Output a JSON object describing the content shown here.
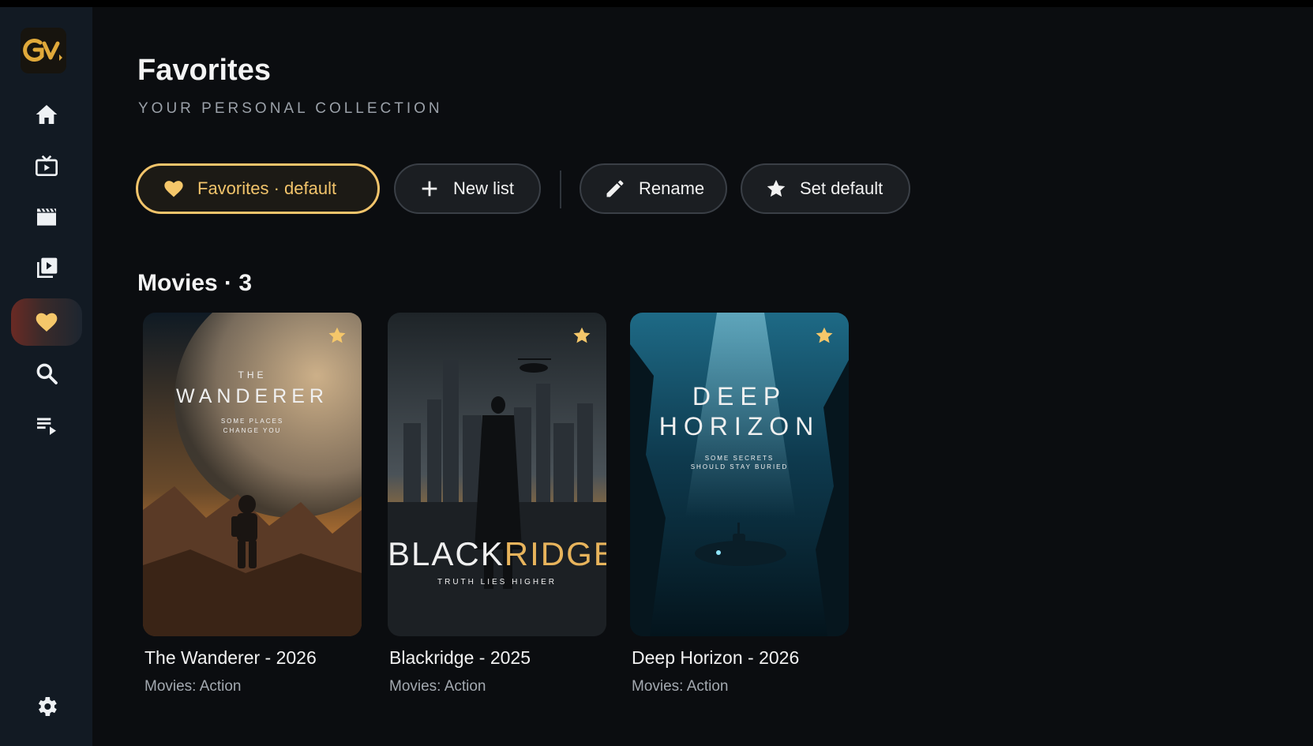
{
  "app": {
    "logo_text": "GV"
  },
  "sidebar": {
    "items": [
      {
        "name": "home",
        "icon": "home-icon",
        "active": false
      },
      {
        "name": "live-tv",
        "icon": "tv-icon",
        "active": false
      },
      {
        "name": "movies",
        "icon": "clapperboard-icon",
        "active": false
      },
      {
        "name": "series",
        "icon": "video-library-icon",
        "active": false
      },
      {
        "name": "favorites",
        "icon": "heart-icon",
        "active": true
      },
      {
        "name": "search",
        "icon": "search-icon",
        "active": false
      },
      {
        "name": "playlist",
        "icon": "playlist-play-icon",
        "active": false
      },
      {
        "name": "settings",
        "icon": "gear-icon",
        "active": false
      }
    ]
  },
  "header": {
    "title": "Favorites",
    "subtitle": "YOUR PERSONAL COLLECTION"
  },
  "toolbar": {
    "list_label": "Favorites · default",
    "new_list_label": "New list",
    "rename_label": "Rename",
    "set_default_label": "Set default"
  },
  "section": {
    "title": "Movies · 3"
  },
  "movies": [
    {
      "title": "The Wanderer - 2026",
      "category": "Movies: Action",
      "poster": {
        "kicker": "THE",
        "headline": "WANDERER",
        "tagline_1": "SOME PLACES",
        "tagline_2": "CHANGE YOU"
      }
    },
    {
      "title": "Blackridge - 2025",
      "category": "Movies: Action",
      "poster": {
        "headline_a": "BLACK",
        "headline_b": "RIDGE",
        "tagline_1": "TRUTH LIES HIGHER"
      }
    },
    {
      "title": "Deep Horizon - 2026",
      "category": "Movies: Action",
      "poster": {
        "headline_1": "DEEP",
        "headline_2": "HORIZON",
        "tagline_1": "SOME SECRETS",
        "tagline_2": "SHOULD STAY BURIED"
      }
    }
  ],
  "colors": {
    "accent": "#f2c46b",
    "background": "#0b0d10",
    "sidebar": "#121a23"
  }
}
